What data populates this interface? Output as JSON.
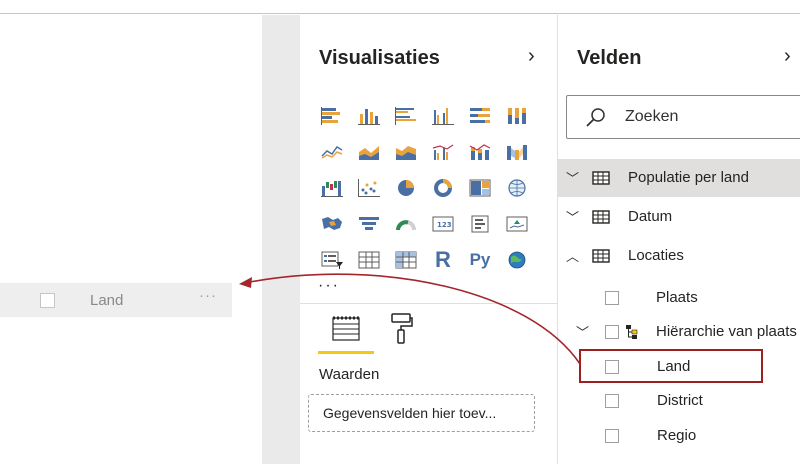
{
  "canvas": {
    "drop_row": {
      "label": "Land",
      "more": "···"
    }
  },
  "visualizations": {
    "title": "Visualisaties",
    "more": "···",
    "icons": [
      [
        "stacked-bar-chart-icon",
        "stacked-column-chart-icon",
        "clustered-bar-chart-icon",
        "clustered-column-chart-icon",
        "100-stacked-bar-chart-icon",
        "100-stacked-column-chart-icon"
      ],
      [
        "line-chart-icon",
        "area-chart-icon",
        "stacked-area-chart-icon",
        "line-clustered-column-chart-icon",
        "line-stacked-column-chart-icon",
        "ribbon-chart-icon"
      ],
      [
        "waterfall-chart-icon",
        "scatter-chart-icon",
        "pie-chart-icon",
        "donut-chart-icon",
        "treemap-icon",
        "map-icon"
      ],
      [
        "filled-map-icon",
        "funnel-icon",
        "gauge-icon",
        "card-icon",
        "multi-row-card-icon",
        "kpi-icon"
      ],
      [
        "slicer-icon",
        "table-icon",
        "matrix-icon",
        "r-visual-icon",
        "python-visual-icon",
        "arcgis-map-icon"
      ]
    ],
    "r_label": "R",
    "py_label": "Py",
    "values_label": "Waarden",
    "well_placeholder": "Gegevensvelden hier toev..."
  },
  "fields": {
    "title": "Velden",
    "search_placeholder": "Zoeken",
    "tables": [
      {
        "label": "Populatie per land",
        "expanded": false,
        "selected": true
      },
      {
        "label": "Datum",
        "expanded": false,
        "selected": false
      },
      {
        "label": "Locaties",
        "expanded": true,
        "selected": false
      }
    ],
    "items": {
      "plaats": "Plaats",
      "hierarchy": "Hiërarchie van plaats",
      "land": "Land",
      "district": "District",
      "regio": "Regio"
    }
  },
  "colors": {
    "accent_yellow": "#f2c811",
    "highlight_red": "#9b2020",
    "arrow_red": "#a4262c"
  }
}
